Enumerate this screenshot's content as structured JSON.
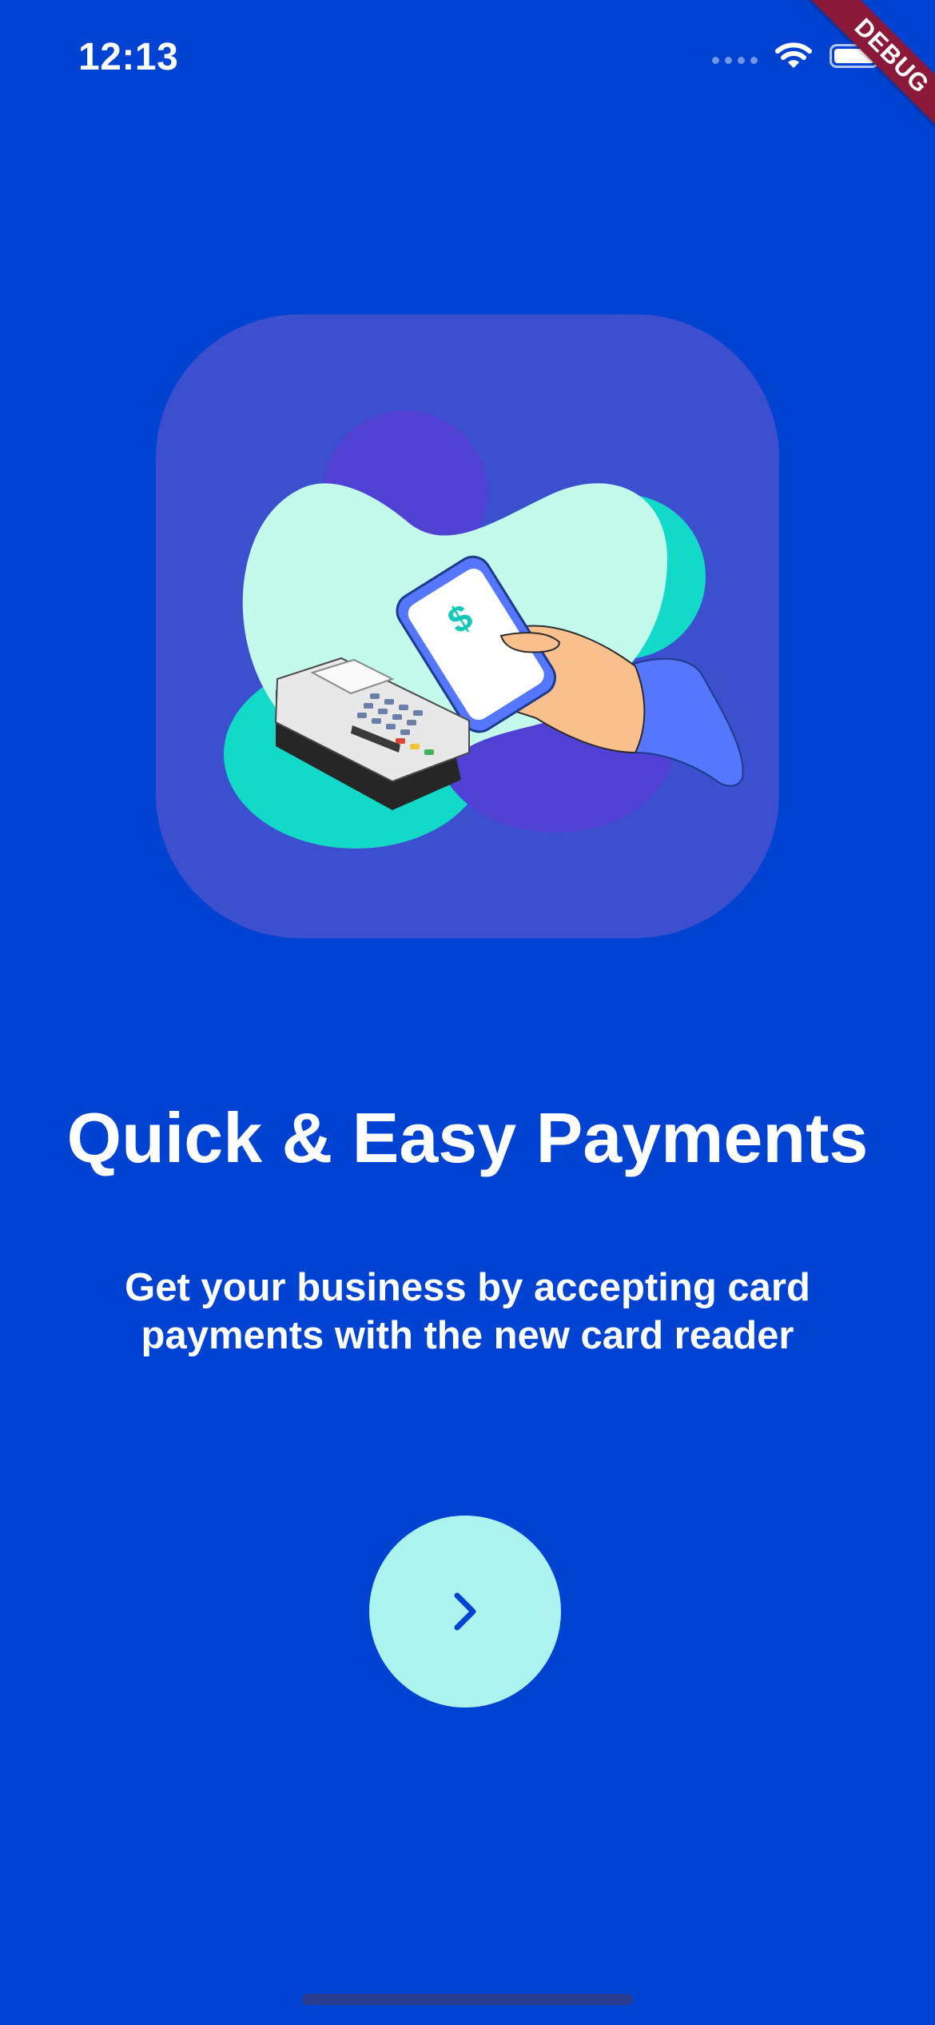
{
  "status_bar": {
    "time": "12:13",
    "signal_icon": "cellular-dots-icon",
    "wifi_icon": "wifi-icon",
    "battery_icon": "battery-icon",
    "battery_level": 1.0
  },
  "debug_banner": {
    "label": "DEBUG",
    "color": "#8B1A3A"
  },
  "illustration": {
    "icon": "contactless-payment-illustration"
  },
  "onboarding": {
    "title": "Quick & Easy Payments",
    "subtitle": "Get your business by accepting card payments with the new card reader"
  },
  "next_button": {
    "icon": "chevron-right-icon"
  },
  "colors": {
    "background": "#0042D1",
    "card": "#3C4FCF",
    "accent_light": "#ACF3EF",
    "text": "#FFFFFF"
  }
}
